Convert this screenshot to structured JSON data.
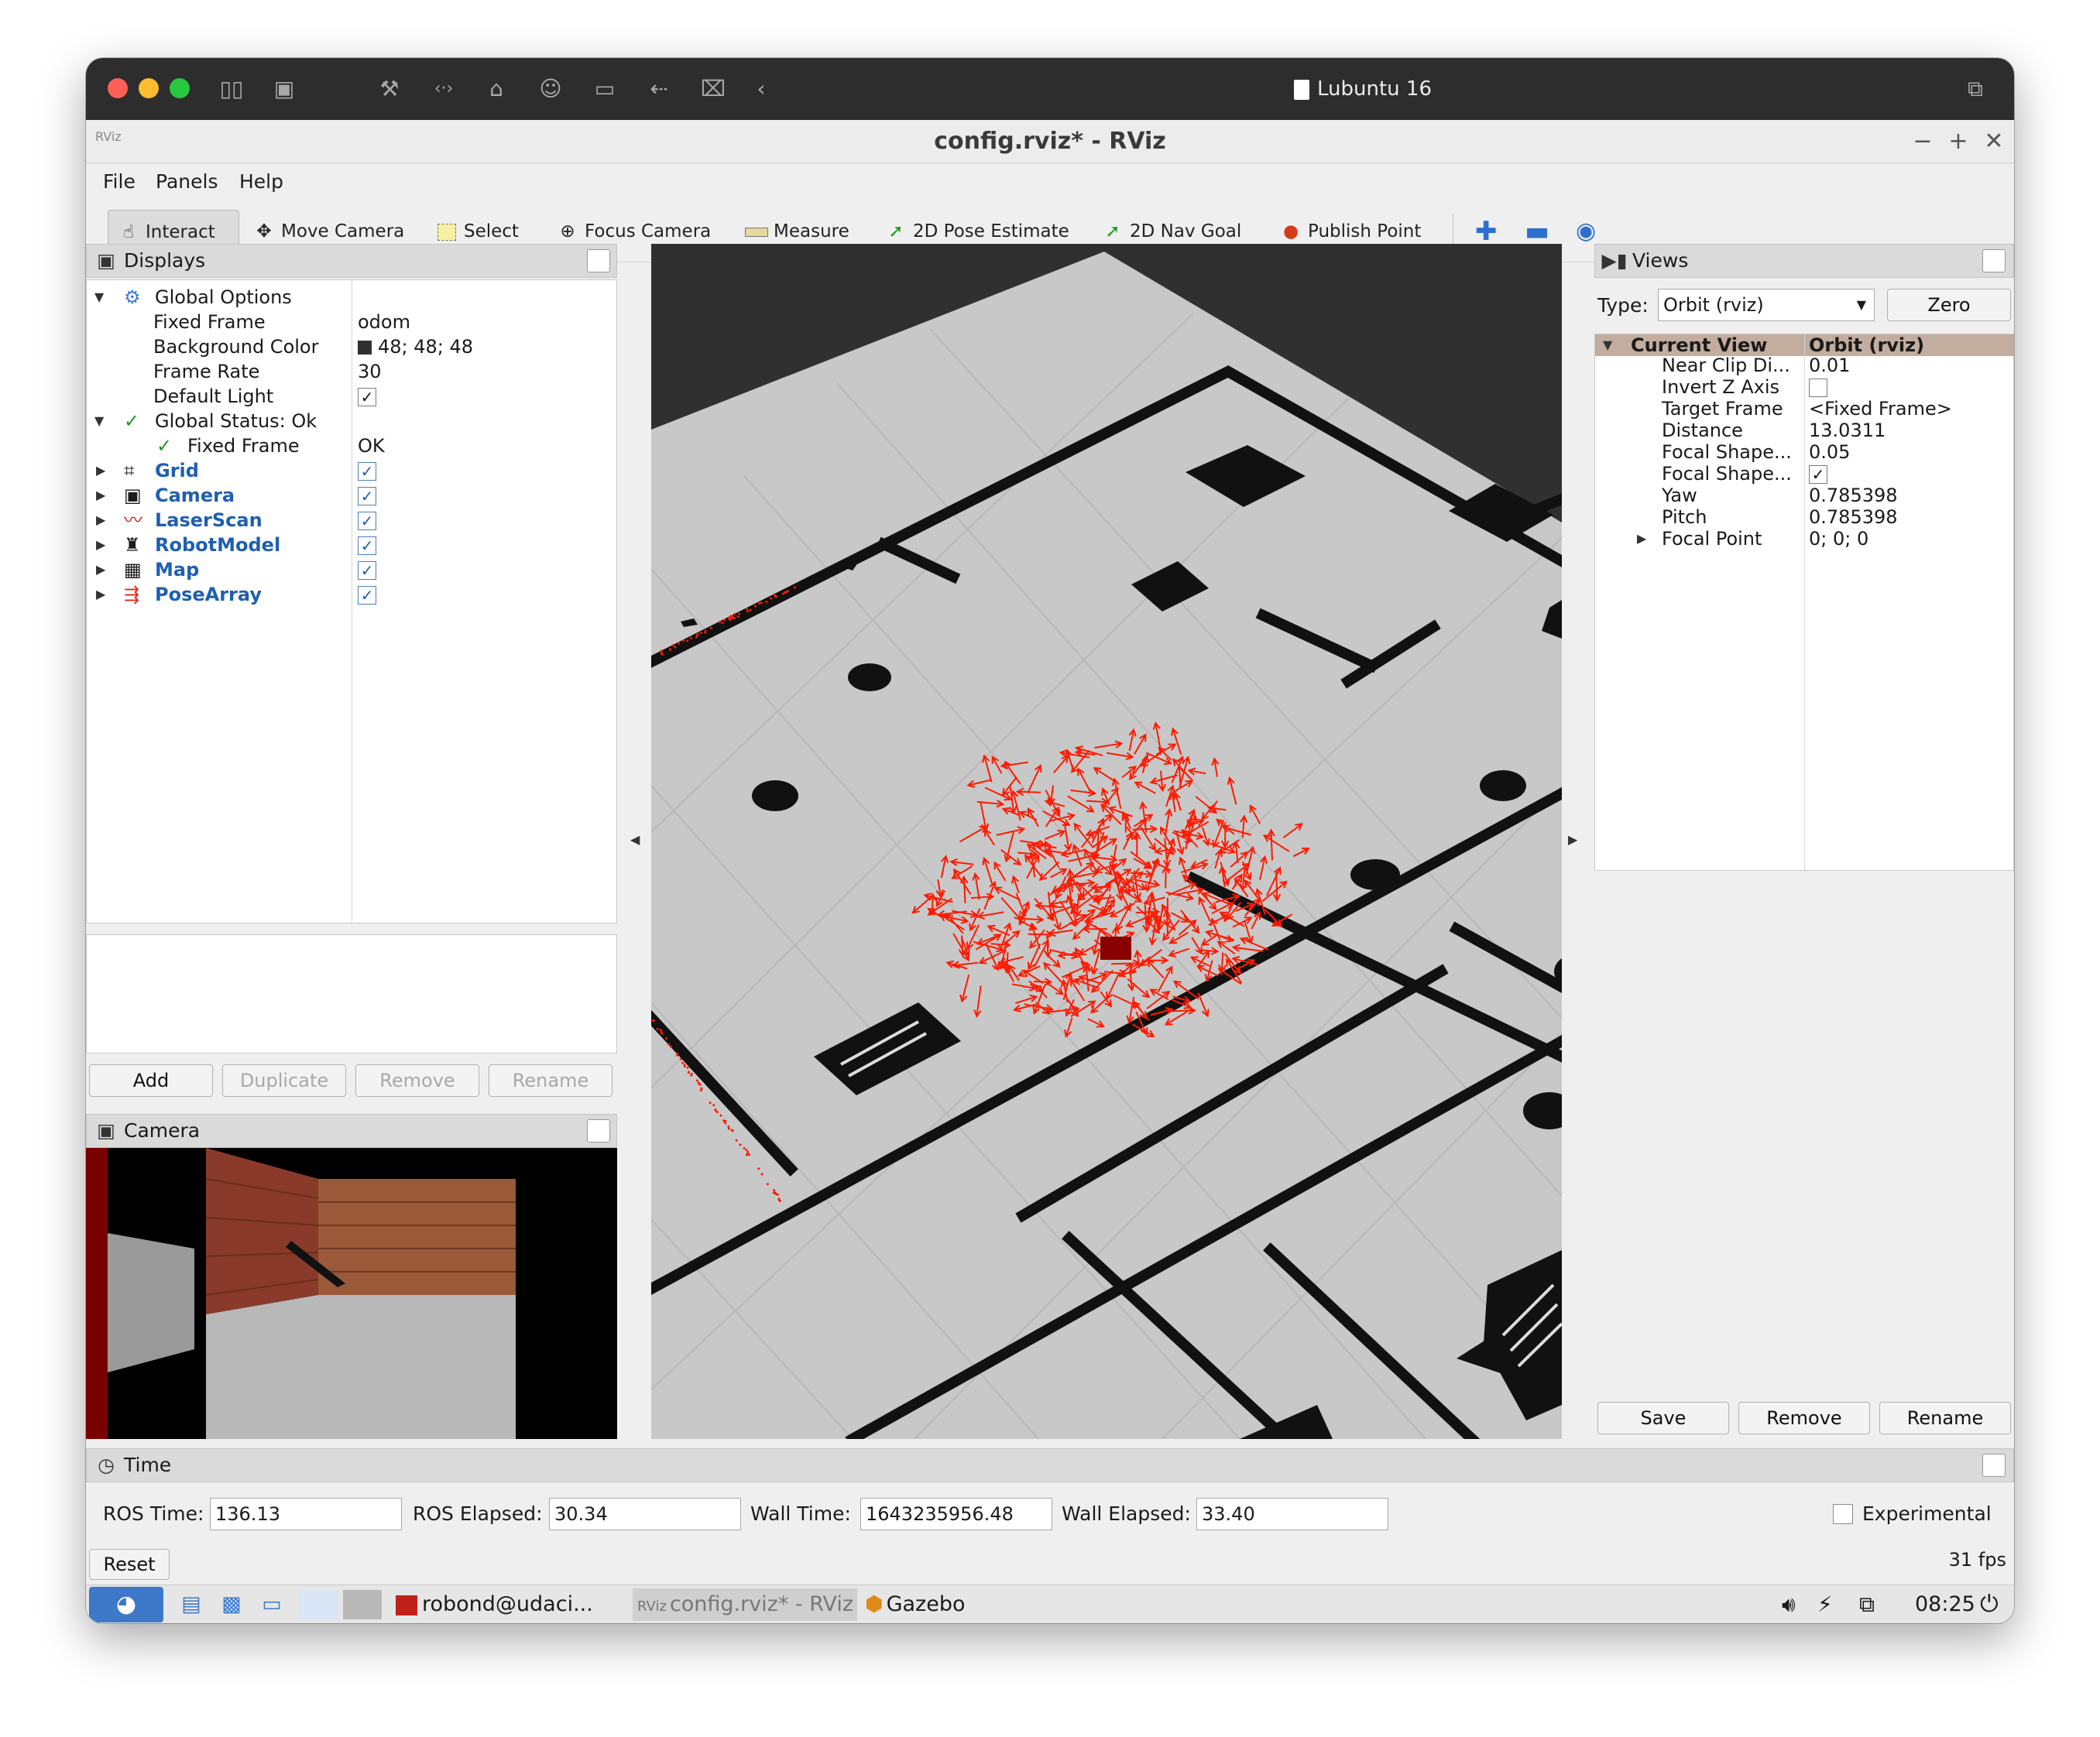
{
  "host": {
    "title": "Lubuntu 16",
    "toolbar_icons": [
      "sidebar-icon",
      "screenshot-icon",
      "wrench-icon",
      "code-icon",
      "drive-icon",
      "user-icon",
      "camera-icon",
      "back-icon",
      "folder-icon",
      "chevron-left-icon"
    ]
  },
  "window": {
    "title": "config.rviz* - RViz",
    "controls": [
      "−",
      "+",
      "✕"
    ]
  },
  "menu": {
    "file": "File",
    "panels": "Panels",
    "help": "Help"
  },
  "toolbar": {
    "interact": "Interact",
    "move_camera": "Move Camera",
    "select": "Select",
    "focus_camera": "Focus Camera",
    "measure": "Measure",
    "pose_estimate": "2D Pose Estimate",
    "nav_goal": "2D Nav Goal",
    "publish_point": "Publish Point"
  },
  "displays": {
    "title": "Displays",
    "global_options": "Global Options",
    "fixed_frame_label": "Fixed Frame",
    "fixed_frame_value": "odom",
    "bg_color_label": "Background Color",
    "bg_color_value": "48; 48; 48",
    "frame_rate_label": "Frame Rate",
    "frame_rate_value": "30",
    "default_light_label": "Default Light",
    "global_status": "Global Status: Ok",
    "status_fixed_frame": "Fixed Frame",
    "status_fixed_frame_value": "OK",
    "items": [
      "Grid",
      "Camera",
      "LaserScan",
      "RobotModel",
      "Map",
      "PoseArray"
    ],
    "buttons": {
      "add": "Add",
      "duplicate": "Duplicate",
      "remove": "Remove",
      "rename": "Rename"
    }
  },
  "camera_panel": {
    "title": "Camera"
  },
  "views": {
    "title": "Views",
    "type_label": "Type:",
    "type_value": "Orbit (rviz)",
    "zero": "Zero",
    "current_view": "Current View",
    "current_view_value": "Orbit (rviz)",
    "props": [
      {
        "name": "Near Clip Di...",
        "value": "0.01"
      },
      {
        "name": "Invert Z Axis",
        "value": ""
      },
      {
        "name": "Target Frame",
        "value": "<Fixed Frame>"
      },
      {
        "name": "Distance",
        "value": "13.0311"
      },
      {
        "name": "Focal Shape...",
        "value": "0.05"
      },
      {
        "name": "Focal Shape...",
        "value": ""
      },
      {
        "name": "Yaw",
        "value": "0.785398"
      },
      {
        "name": "Pitch",
        "value": "0.785398"
      },
      {
        "name": "Focal Point",
        "value": "0; 0; 0"
      }
    ],
    "buttons": {
      "save": "Save",
      "remove": "Remove",
      "rename": "Rename"
    }
  },
  "time": {
    "title": "Time",
    "ros_time_label": "ROS Time:",
    "ros_time": "136.13",
    "ros_elapsed_label": "ROS Elapsed:",
    "ros_elapsed": "30.34",
    "wall_time_label": "Wall Time:",
    "wall_time": "1643235956.48",
    "wall_elapsed_label": "Wall Elapsed:",
    "wall_elapsed": "33.40",
    "experimental": "Experimental",
    "reset": "Reset",
    "fps": "31 fps"
  },
  "taskbar": {
    "terminal": "robond@udaci...",
    "rviz": "config.rviz* - RViz",
    "gazebo": "Gazebo",
    "clock": "08:25"
  },
  "colors": {
    "grid_bg": "#303030",
    "map_floor": "#c8c8c8",
    "particles": "#ff1a00",
    "accent_blue": "#1f5fb0"
  }
}
